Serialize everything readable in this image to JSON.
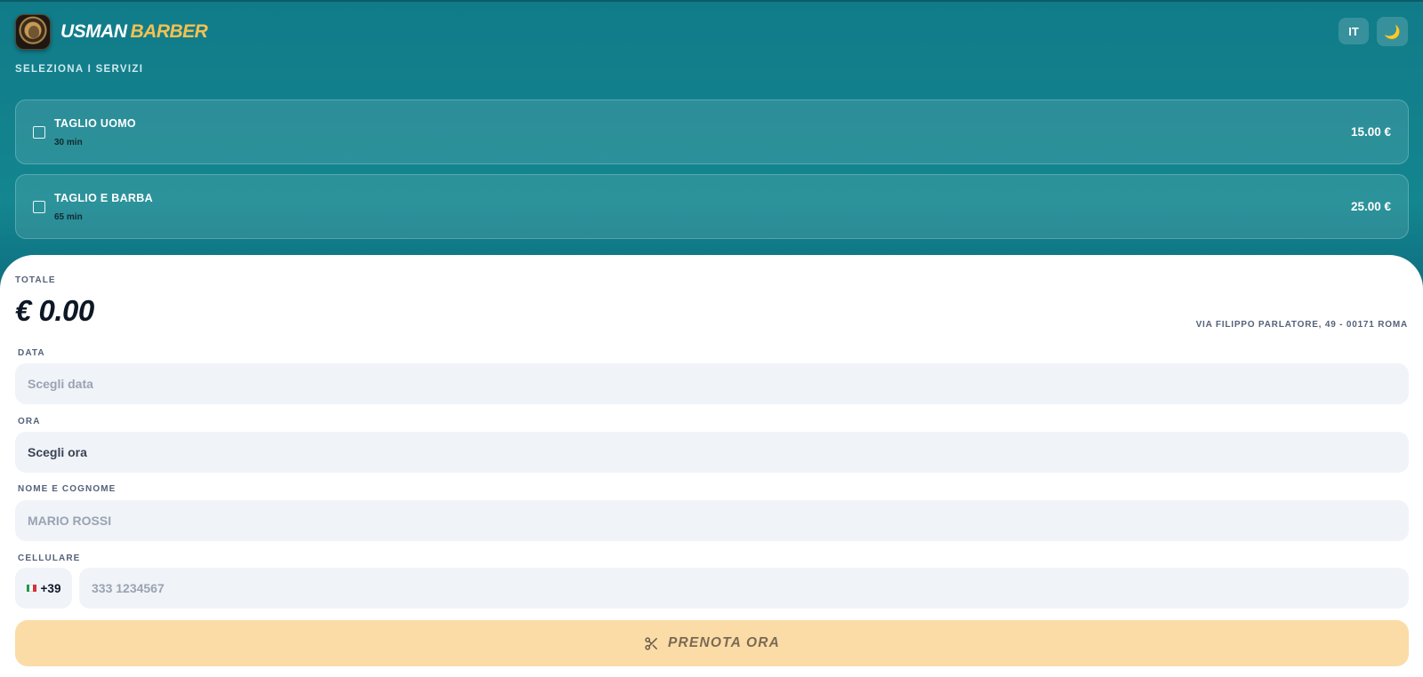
{
  "header": {
    "brand_first": "USMAN",
    "brand_second": "BARBER",
    "language_label": "IT",
    "theme_icon": "🌙"
  },
  "services": {
    "section_title": "SELEZIONA I SERVIZI",
    "items": [
      {
        "name": "TAGLIO UOMO",
        "duration": "30 min",
        "price": "15.00 €",
        "checked": false
      },
      {
        "name": "TAGLIO E BARBA",
        "duration": "65 min",
        "price": "25.00 €",
        "checked": false
      }
    ]
  },
  "booking": {
    "total_label": "TOTALE",
    "total_value": "€ 0.00",
    "address": "VIA FILIPPO PARLATORE, 49 - 00171 ROMA",
    "date_label": "DATA",
    "date_placeholder": "Scegli data",
    "time_label": "ORA",
    "time_value": "Scegli ora",
    "name_label": "NOME E COGNOME",
    "name_placeholder": "MARIO ROSSI",
    "phone_label": "CELLULARE",
    "phone_prefix": "+39",
    "phone_placeholder": "333 1234567",
    "submit_label": "PRENOTA ORA"
  },
  "colors": {
    "teal": "#117b89",
    "gold": "#f4c151",
    "cta_bg": "#fbdca6"
  }
}
